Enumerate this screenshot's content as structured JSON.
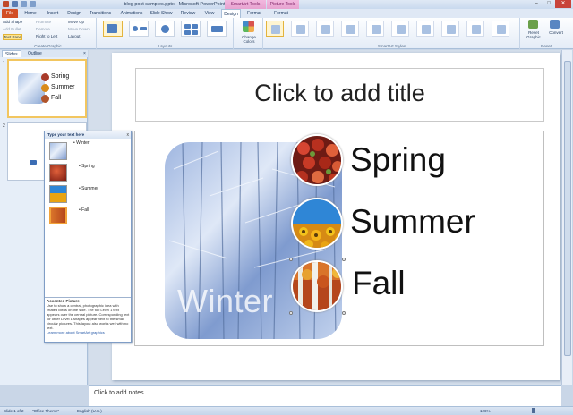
{
  "window": {
    "title": "blog post samples.pptx - Microsoft PowerPoint",
    "contextual_tabs": [
      "SmartArt Tools",
      "Picture Tools"
    ]
  },
  "tabs": [
    "File",
    "Home",
    "Insert",
    "Design",
    "Transitions",
    "Animations",
    "Slide Show",
    "Review",
    "View",
    "Design",
    "Format",
    "Format"
  ],
  "ribbon": {
    "create_graphic": {
      "items": [
        "Add Shape",
        "Add Bullet",
        "Text Pane",
        "Promote",
        "Demote",
        "Right to Left",
        "Move Up",
        "Move Down",
        "Layout"
      ],
      "label": "Create Graphic"
    },
    "layouts_label": "Layouts",
    "change_colors": "Change Colors",
    "styles_label": "SmartArt Styles",
    "reset": {
      "reset_graphic": "Reset Graphic",
      "convert": "Convert",
      "label": "Reset"
    }
  },
  "panel": {
    "tabs": [
      "Slides",
      "Outline"
    ],
    "slide_numbers": [
      "1",
      "2"
    ]
  },
  "thumbnail": {
    "labels": [
      "Spring",
      "Summer",
      "Fall"
    ]
  },
  "slide": {
    "title_placeholder": "Click to add title",
    "main_label": "Winter",
    "items": [
      "Spring",
      "Summer",
      "Fall"
    ]
  },
  "text_pane": {
    "title": "Type your text here",
    "close": "x",
    "items": [
      "Winter",
      "Spring",
      "Summer",
      "Fall"
    ],
    "desc_title": "Accented Picture",
    "desc_body": "Use to show a central, photographic idea with related ideas on the side. The top Level 1 text appears over the central picture. Corresponding text for other Level 1 shapes appear next to the small circular pictures. This layout also works well with no text.",
    "desc_link": "Learn more about SmartArt graphics"
  },
  "notes": {
    "placeholder": "Click to add notes"
  },
  "status": {
    "slide": "Slide 1 of 2",
    "theme": "\"Office Theme\"",
    "language": "English (U.S.)",
    "zoom": "126%"
  },
  "colors": {
    "file_tab": "#d24e26",
    "accent_select": "#f2c660",
    "ribbon_bg": "#e4ecf7"
  }
}
